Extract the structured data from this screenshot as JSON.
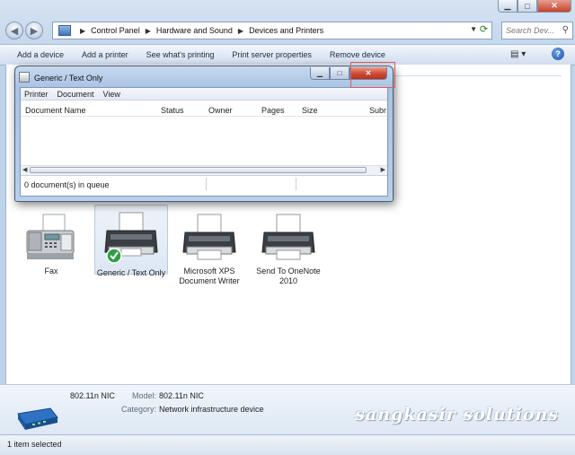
{
  "explorer": {
    "breadcrumb": [
      "Control Panel",
      "Hardware and Sound",
      "Devices and Printers"
    ],
    "search_placeholder": "Search Dev...",
    "toolbar": [
      "Add a device",
      "Add a printer",
      "See what's printing",
      "Print server properties",
      "Remove device"
    ]
  },
  "devices": [
    {
      "name": "Fax",
      "icon": "fax-icon"
    },
    {
      "name": "Generic / Text Only",
      "icon": "printer-default-icon",
      "selected": true
    },
    {
      "name": "Microsoft XPS Document Writer",
      "icon": "printer-icon"
    },
    {
      "name": "Send To OneNote 2010",
      "icon": "printer-icon"
    }
  ],
  "details": {
    "device_name": "802.11n NIC",
    "model_label": "Model:",
    "model_value": "802.11n NIC",
    "category_label": "Category:",
    "category_value": "Network infrastructure device",
    "icon": "network-device-icon"
  },
  "status_bar": "1 item selected",
  "watermark": "sangkasir solutions",
  "print_queue": {
    "title": "Generic / Text Only",
    "menu": [
      "Printer",
      "Document",
      "View"
    ],
    "columns": [
      "Document Name",
      "Status",
      "Owner",
      "Pages",
      "Size",
      "Subr"
    ],
    "status": "0 document(s) in queue"
  }
}
